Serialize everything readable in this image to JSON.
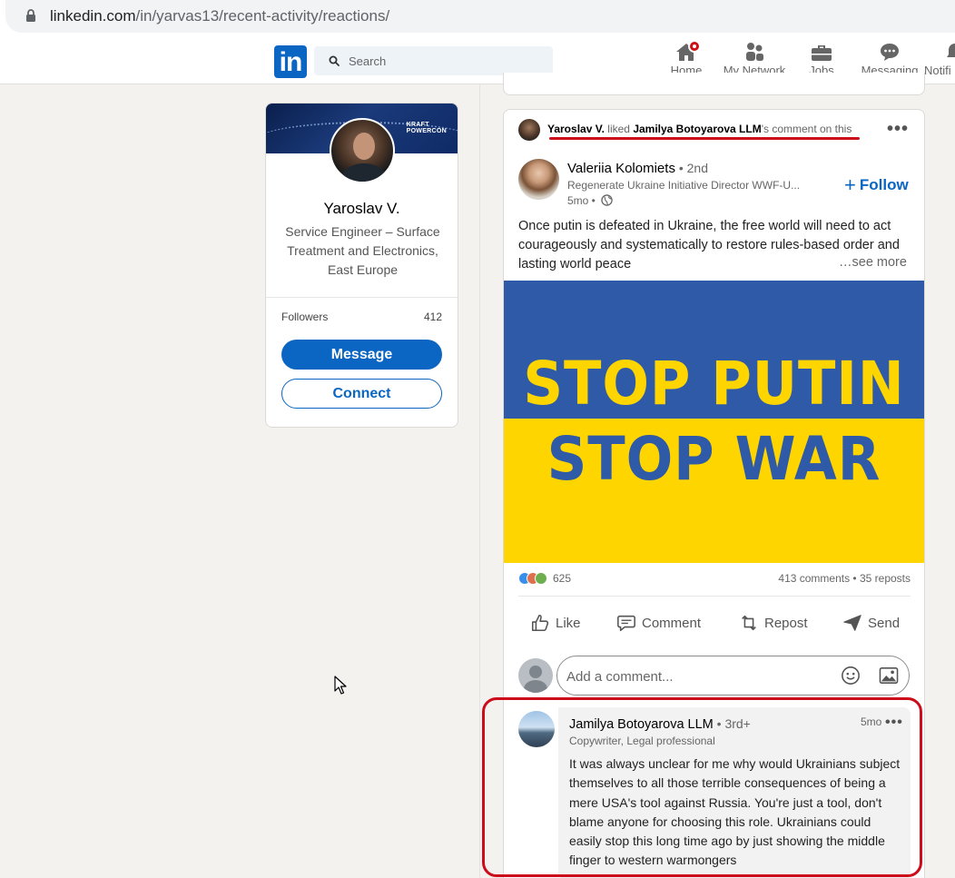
{
  "browser": {
    "url_host": "linkedin.com",
    "url_path": "/in/yarvas13/recent-activity/reactions/"
  },
  "nav": {
    "logo": "in",
    "search_placeholder": "Search",
    "items": [
      {
        "label": "Home",
        "icon": "home-icon"
      },
      {
        "label": "My Network",
        "icon": "network-icon"
      },
      {
        "label": "Jobs",
        "icon": "briefcase-icon"
      },
      {
        "label": "Messaging",
        "icon": "messaging-icon"
      },
      {
        "label": "Notifi",
        "icon": "bell-icon"
      }
    ]
  },
  "profile": {
    "banner_brand_line1": "KRAFT",
    "banner_brand_line2": "POWERCON",
    "name": "Yaroslav V.",
    "headline": "Service Engineer – Surface Treatment and Electronics, East Europe",
    "followers_label": "Followers",
    "followers_count": "412",
    "message_label": "Message",
    "connect_label": "Connect"
  },
  "activity": {
    "actor": "Yaroslav V.",
    "verb": " liked ",
    "target": "Jamilya Botoyarova LLM",
    "suffix": "'s comment on this"
  },
  "post": {
    "author_name": "Valeriia Kolomiets",
    "author_degree": " • 2nd",
    "author_headline": "Regenerate Ukraine Initiative Director WWF-U...",
    "time": "5mo •",
    "follow_label": "Follow",
    "text": "Once putin is defeated in Ukraine, the free world will need to act courageously and systematically to restore rules-based order and lasting world peace",
    "see_more": "…see more",
    "image_line1": "STOP PUTIN",
    "image_line2": "STOP WAR",
    "image_colors": {
      "top": "#2e5aa8",
      "bottom": "#ffd500"
    },
    "reactions_count": "625",
    "comments_reposts": "413 comments • 35 reposts",
    "actions": [
      {
        "label": "Like",
        "icon": "like-icon"
      },
      {
        "label": "Comment",
        "icon": "comment-icon"
      },
      {
        "label": "Repost",
        "icon": "repost-icon"
      },
      {
        "label": "Send",
        "icon": "send-icon"
      }
    ],
    "comment_placeholder": "Add a comment..."
  },
  "comment": {
    "name": "Jamilya Botoyarova LLM",
    "degree": " • 3rd+",
    "headline": "Copywriter, Legal professional",
    "time": "5mo",
    "text": "It was always unclear for me why would Ukrainians subject themselves to all those terrible consequences of being a mere USA's tool against Russia. You're just a tool, don't blame anyone for choosing this role. Ukrainians could easily stop this long time ago by just showing the middle finger to western warmongers"
  },
  "colors": {
    "linkedin_blue": "#0a66c2",
    "highlight_red": "#cc0c1a",
    "notification_red": "#cc1016"
  }
}
